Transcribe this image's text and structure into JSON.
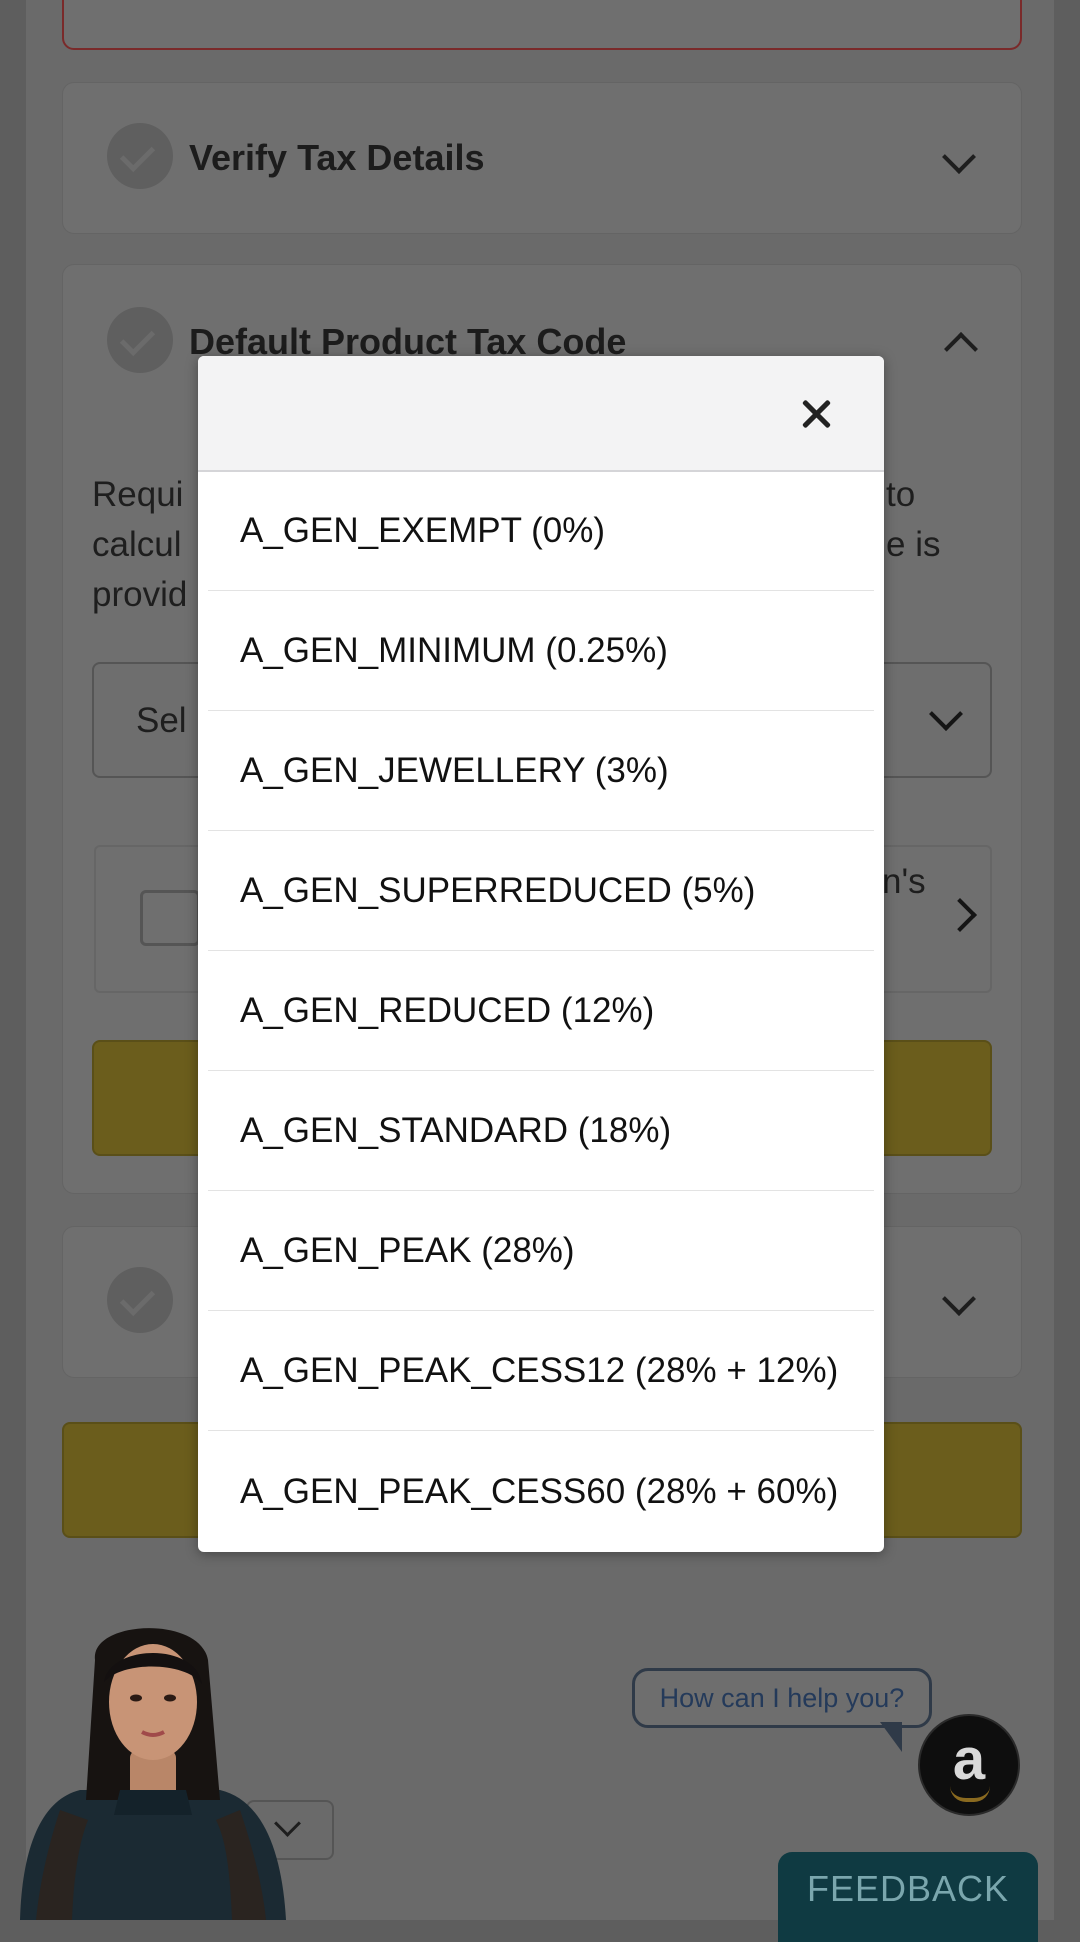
{
  "background": {
    "sections": [
      {
        "title": "Verify Tax Details"
      },
      {
        "title": "Default Product Tax Code"
      }
    ],
    "description_lines": [
      "Requi",
      "calcul",
      "provid"
    ],
    "description_right": [
      "to",
      "e is"
    ],
    "select_placeholder": "Sel",
    "inner_text": "n's"
  },
  "modal": {
    "options": [
      "A_GEN_EXEMPT (0%)",
      "A_GEN_MINIMUM (0.25%)",
      "A_GEN_JEWELLERY (3%)",
      "A_GEN_SUPERREDUCED (5%)",
      "A_GEN_REDUCED (12%)",
      "A_GEN_STANDARD (18%)",
      "A_GEN_PEAK (28%)",
      "A_GEN_PEAK_CESS12 (28% + 12%)",
      "A_GEN_PEAK_CESS60 (28% + 60%)"
    ]
  },
  "chat": {
    "prompt": "How can I help you?",
    "icon_letter": "a"
  },
  "feedback_label": "FEEDBACK",
  "colors": {
    "accent_button": "#6b5d1c",
    "feedback": "#0f3a42"
  }
}
